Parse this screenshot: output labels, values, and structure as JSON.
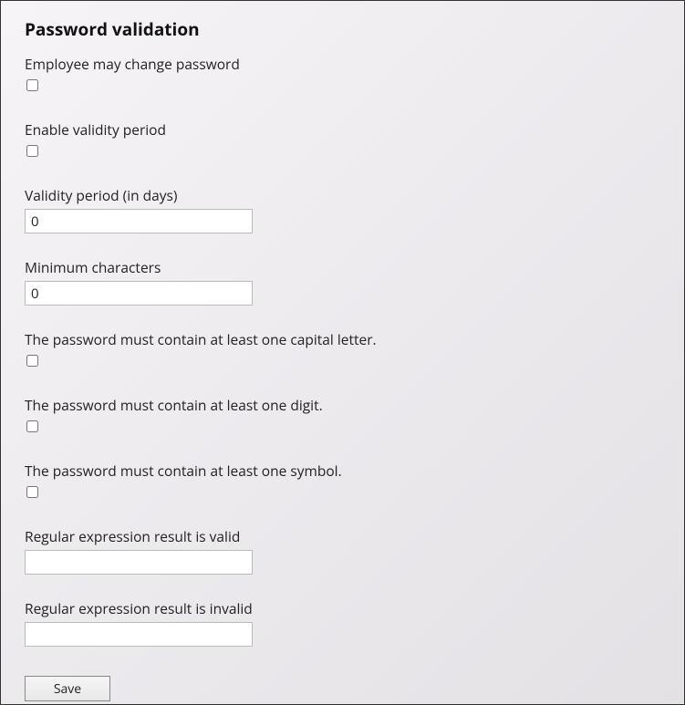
{
  "title": "Password validation",
  "fields": {
    "employee_may_change": {
      "label": "Employee may change password",
      "checked": false
    },
    "enable_validity_period": {
      "label": "Enable validity period",
      "checked": false
    },
    "validity_period_days": {
      "label": "Validity period (in days)",
      "value": "0"
    },
    "minimum_characters": {
      "label": "Minimum characters",
      "value": "0"
    },
    "require_capital": {
      "label": "The password must contain at least one capital letter.",
      "checked": false
    },
    "require_digit": {
      "label": "The password must contain at least one digit.",
      "checked": false
    },
    "require_symbol": {
      "label": "The password must contain at least one symbol.",
      "checked": false
    },
    "regex_valid": {
      "label": "Regular expression result is valid",
      "value": ""
    },
    "regex_invalid": {
      "label": "Regular expression result is invalid",
      "value": ""
    }
  },
  "buttons": {
    "save": "Save"
  }
}
